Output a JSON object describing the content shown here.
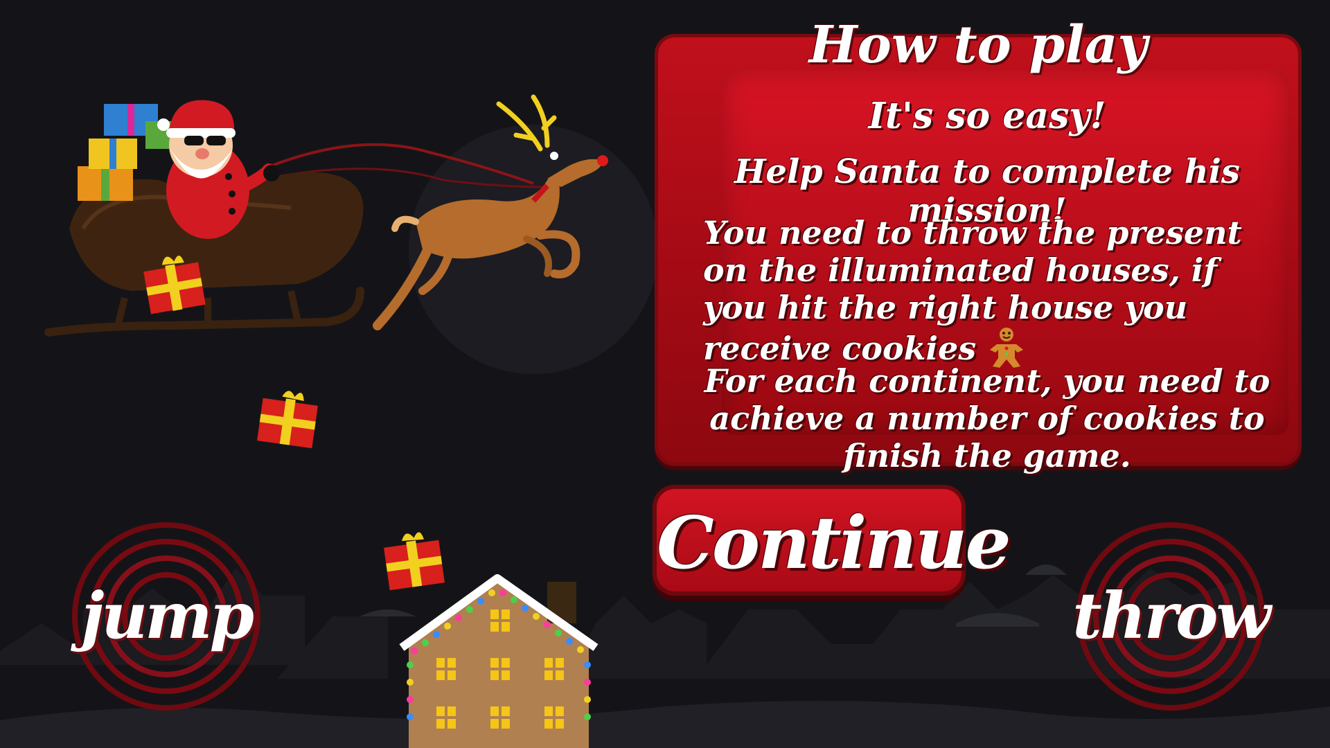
{
  "panel": {
    "title": "How to play",
    "subtitle": "It's so easy!",
    "line_help": "Help Santa to complete his mission!",
    "line_throw": "You need to throw the present on the illuminated houses, if you hit the right house you receive cookies",
    "line_continents": "For each continent, you need to achieve a number of cookies to finish the game."
  },
  "buttons": {
    "continue_label": "Continue",
    "jump_label": "jump",
    "throw_label": "throw"
  },
  "icons": {
    "cookie": "gingerbread-man-icon",
    "present": "gift-icon"
  },
  "colors": {
    "background": "#141418",
    "panel_red": "#b20c18",
    "button_ring": "#7a0a12",
    "text": "#ffffff"
  }
}
